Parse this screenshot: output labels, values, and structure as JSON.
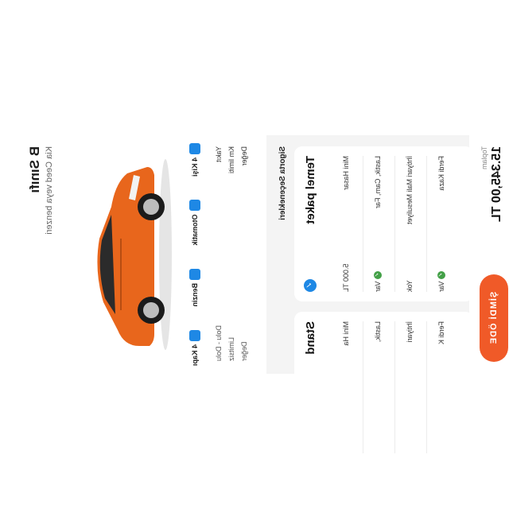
{
  "car": {
    "class_title": "B Sınıfı",
    "subtitle": "Kia Ceed veya benzeri"
  },
  "features": [
    {
      "icon": "seat-icon",
      "label": "4 Kişi"
    },
    {
      "icon": "gearbox-icon",
      "label": "Otomatik"
    },
    {
      "icon": "fuel-icon",
      "label": "Benzin"
    },
    {
      "icon": "door-icon",
      "label": "4 Kapı"
    }
  ],
  "specs": {
    "left_labels": [
      "Yakıt",
      "Km limiti",
      ""
    ],
    "right_values": [
      "Dolu - Dolu",
      "Limitsiz",
      "Değer"
    ],
    "left_extra": "Değer"
  },
  "section_title": "Sigorta Seçenekleri",
  "package_a": {
    "title": "Temel paket",
    "rows": [
      {
        "label": "Mini Hasar",
        "value": "5.000 TL",
        "check": false
      },
      {
        "label": "Lastik, Cam, Far",
        "value": "Var",
        "check": true
      },
      {
        "label": "İhtiyari Mali Mesuliyet",
        "value": "Yok",
        "check": false
      },
      {
        "label": "Ferdi Kaza",
        "value": "Var",
        "check": true
      }
    ]
  },
  "package_b": {
    "title": "Stand",
    "rows": [
      {
        "label": "Mini Ha"
      },
      {
        "label": "Lastik, "
      },
      {
        "label": "İhtiyari"
      },
      {
        "label": "Ferdi K"
      }
    ]
  },
  "footer": {
    "total_label": "Toplam",
    "total_value": "15.345,00 TL",
    "pay_button": "ŞİMDİ ÖDE"
  },
  "colors": {
    "accent": "#f05a28",
    "icon_blue": "#1e88e5",
    "check_green": "#43a047",
    "car_orange": "#e8661c"
  }
}
